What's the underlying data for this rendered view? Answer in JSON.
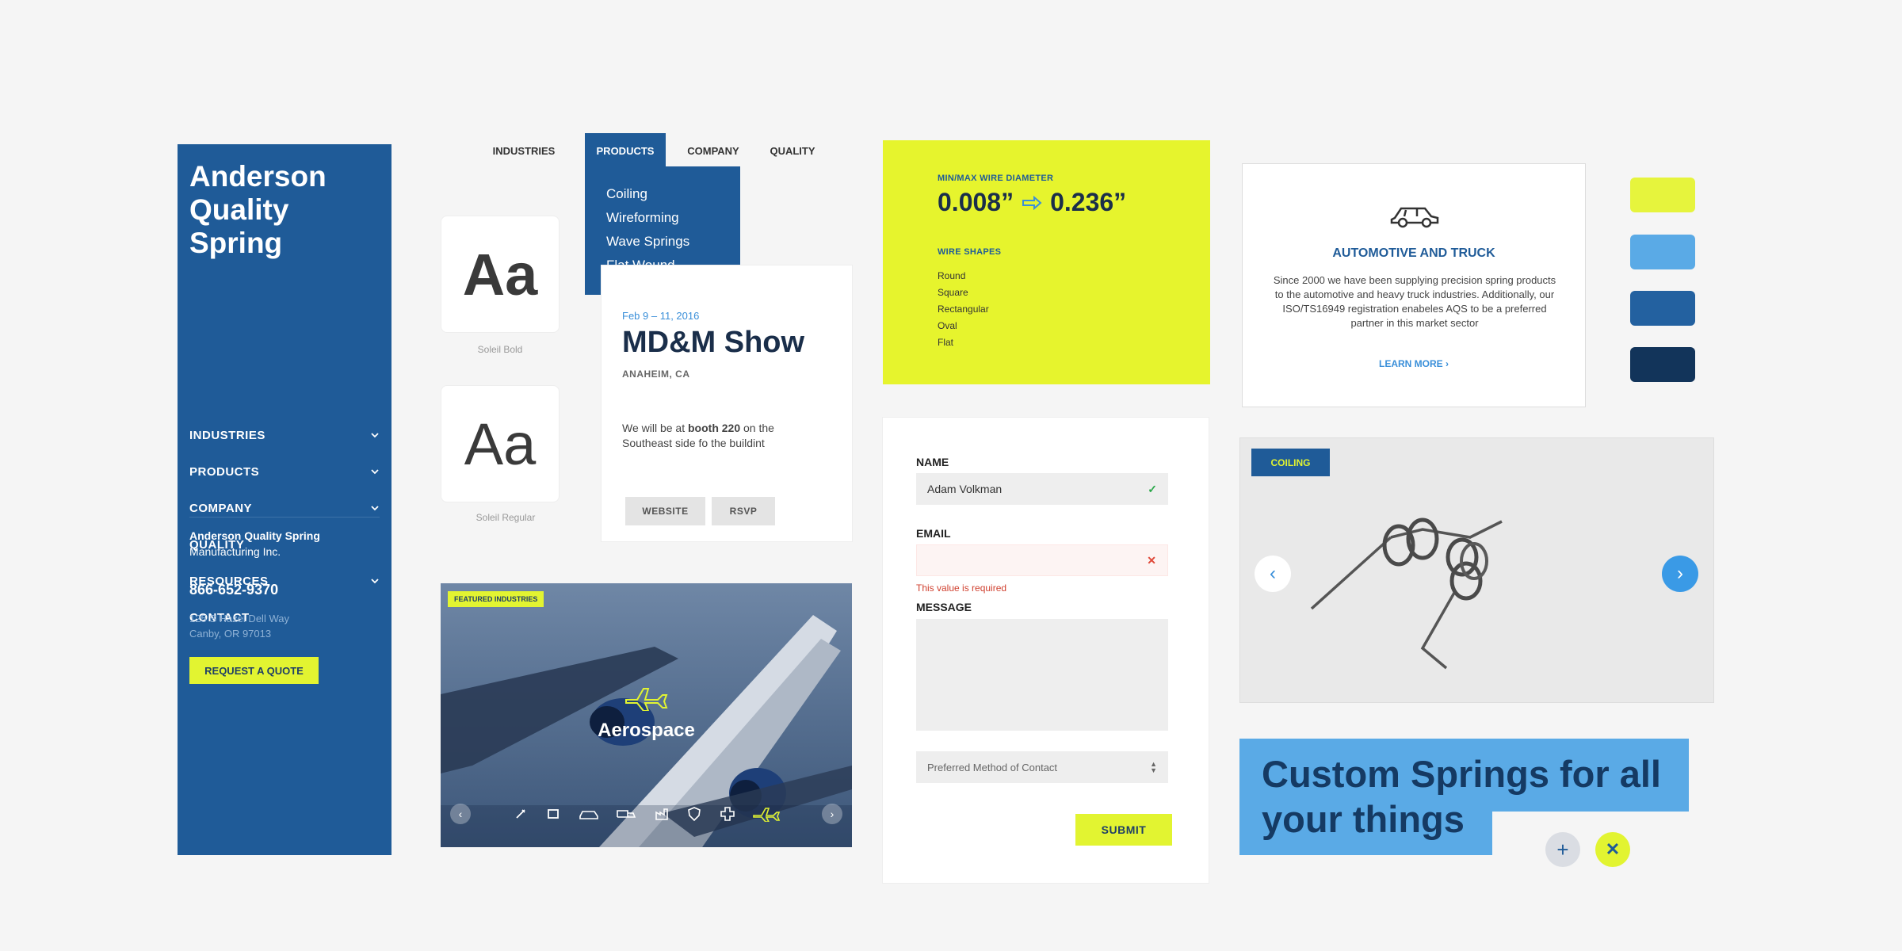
{
  "sidebar": {
    "brand": "Anderson Quality Spring",
    "items": [
      {
        "label": "INDUSTRIES",
        "chevron": true
      },
      {
        "label": "PRODUCTS",
        "chevron": true
      },
      {
        "label": "COMPANY",
        "chevron": true
      },
      {
        "label": "QUALITY",
        "chevron": false
      },
      {
        "label": "RESOURCES",
        "chevron": true
      },
      {
        "label": "CONTACT",
        "chevron": false
      }
    ],
    "company_name": "Anderson Quality Spring",
    "company_sub": "Manufacturing Inc.",
    "phone": "866-652-9370",
    "address1": "125 S Hazel Dell Way",
    "address2": "Canby, OR 97013",
    "quote_button": "REQUEST A QUOTE"
  },
  "topnav": {
    "items": [
      "INDUSTRIES",
      "PRODUCTS",
      "COMPANY",
      "QUALITY"
    ],
    "active": "PRODUCTS",
    "dropdown": [
      "Coiling",
      "Wireforming",
      "Wave Springs",
      "Flat Wound"
    ]
  },
  "fonts": {
    "sample": "Aa",
    "bold_label": "Soleil Bold",
    "regular_label": "Soleil Regular"
  },
  "event": {
    "date": "Feb 9 – 11, 2016",
    "title": "MD&M Show",
    "location": "ANAHEIM, CA",
    "desc_pre": "We will be at ",
    "desc_bold": "booth 220",
    "desc_post": " on the Southeast side fo the buildint",
    "website_button": "WEBSITE",
    "rsvp_button": "RSVP"
  },
  "spec": {
    "diameter_label": "MIN/MAX WIRE DIAMETER",
    "min": "0.008”",
    "max": "0.236”",
    "shapes_label": "WIRE SHAPES",
    "shapes": [
      "Round",
      "Square",
      "Rectangular",
      "Oval",
      "Flat"
    ]
  },
  "form": {
    "name_label": "NAME",
    "name_value": "Adam Volkman",
    "email_label": "EMAIL",
    "email_value": "",
    "email_error": "This value is required",
    "message_label": "MESSAGE",
    "contact_select": "Preferred Method of Contact",
    "submit": "SUBMIT"
  },
  "auto": {
    "title": "AUTOMOTIVE AND TRUCK",
    "desc": "Since 2000 we have been supplying precision spring products to the automotive and heavy truck industries. Additionally, our ISO/TS16949 registration enabeles AQS to be a preferred partner in this market sector",
    "link": "LEARN MORE"
  },
  "swatches": [
    "#e6f43d",
    "#5aaae6",
    "#2361a0",
    "#12345a"
  ],
  "carousel": {
    "tag": "COILING"
  },
  "hero": {
    "line1": "Custom Springs for all",
    "line2": "your things"
  },
  "aerospace": {
    "tag": "FEATURED INDUSTRIES",
    "title": "Aerospace"
  },
  "colors": {
    "navy": "#1f5b98",
    "lime": "#e6f42d",
    "sky": "#5aaae6",
    "dark": "#12345a"
  }
}
